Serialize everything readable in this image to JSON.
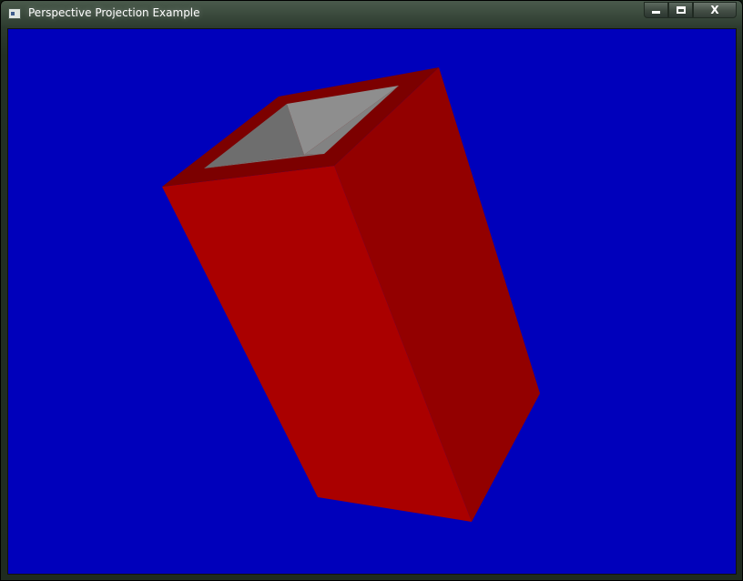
{
  "window": {
    "title": "Perspective Projection Example",
    "icon": "app-window-icon"
  },
  "caption_buttons": {
    "minimize_icon": "minimize-icon",
    "maximize_icon": "maximize-icon",
    "close_label": "X"
  },
  "scene": {
    "background_color": "#0000bb",
    "object": "open-top red box",
    "outer_front_color": "#aa0000",
    "outer_right_color": "#930000",
    "rim_color": "#7c0000",
    "inner_light_color": "#8e8e8e",
    "inner_dark_color": "#6e6e6e"
  }
}
